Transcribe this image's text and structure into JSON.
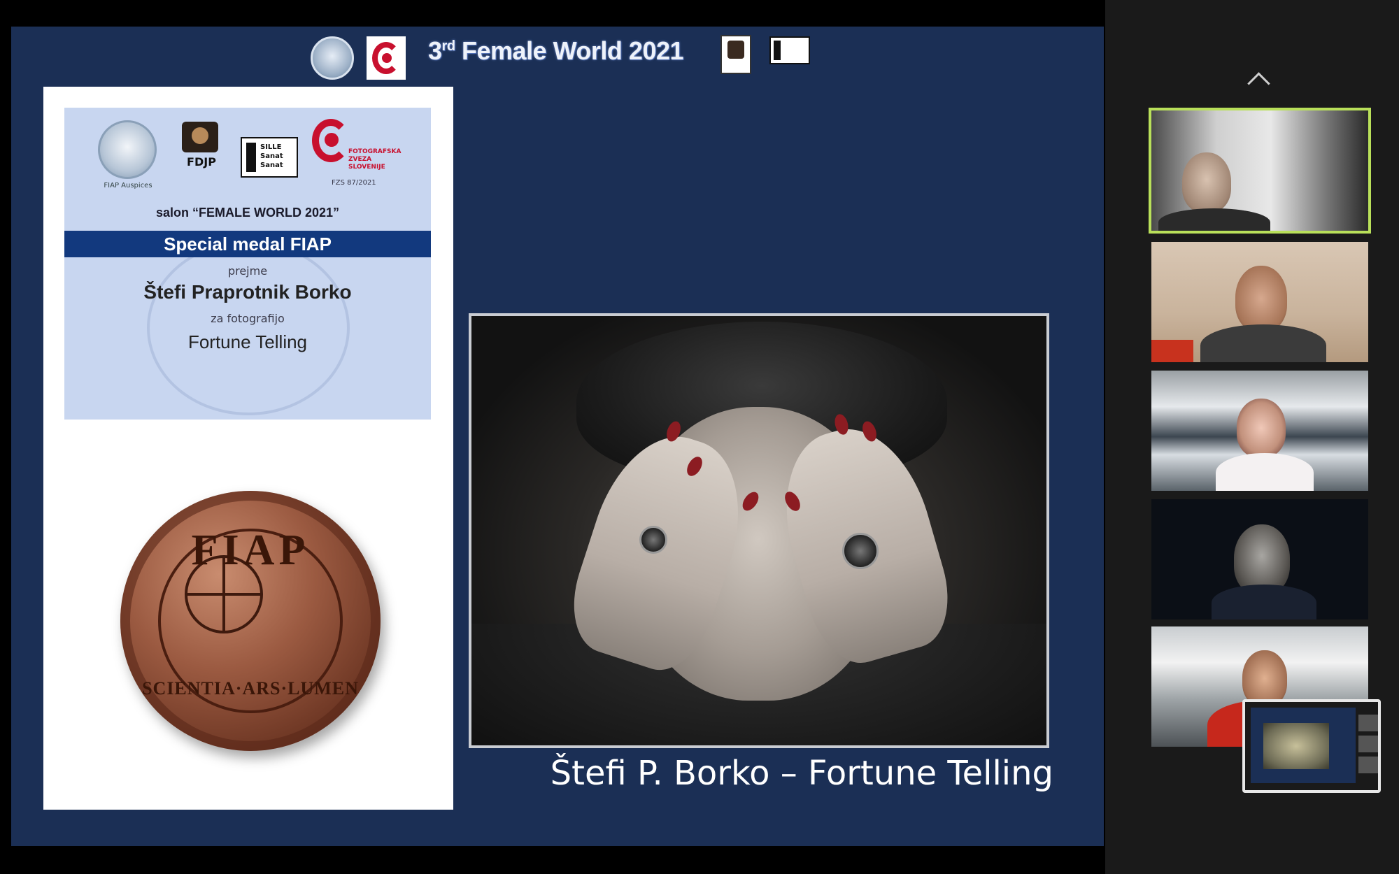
{
  "slide": {
    "header_title": "3rd Female World 2021",
    "certificate": {
      "fiap_caption": "FIAP Auspices",
      "fdjp_label": "FDJP",
      "sille_text": [
        "SILLE",
        "Sanat",
        "Sanat"
      ],
      "fzs_text": [
        "FOTOGRAFSKA",
        "ZVEZA",
        "SLOVENIJE"
      ],
      "fzs_code": "FZS 87/2021",
      "salon_line": "salon “FEMALE WORLD 2021”",
      "medal_band": "Special medal FIAP",
      "receives": "prejme",
      "author_name": "Štefi Praprotnik Borko",
      "for_photo": "za fotografijo",
      "photo_title": "Fortune Telling",
      "medal_text": "FIAP",
      "medal_motto": "SCIENTIA·ARS·LUMEN"
    },
    "caption": "Štefi P. Borko – Fortune Telling"
  },
  "colors": {
    "slide_bg": "#1b2f55",
    "medal_band": "#12397e",
    "active_speaker": "#b9e05a",
    "panel_bg": "#1a1a1a"
  },
  "panel": {
    "scroll_icon": "chevron-up-icon",
    "tiles": [
      {
        "name": "participant-1",
        "active": true
      },
      {
        "name": "participant-2",
        "active": false
      },
      {
        "name": "participant-3",
        "active": false
      },
      {
        "name": "participant-4",
        "active": false
      },
      {
        "name": "participant-5",
        "active": false
      }
    ],
    "self_view": "self-view-thumbnail"
  }
}
